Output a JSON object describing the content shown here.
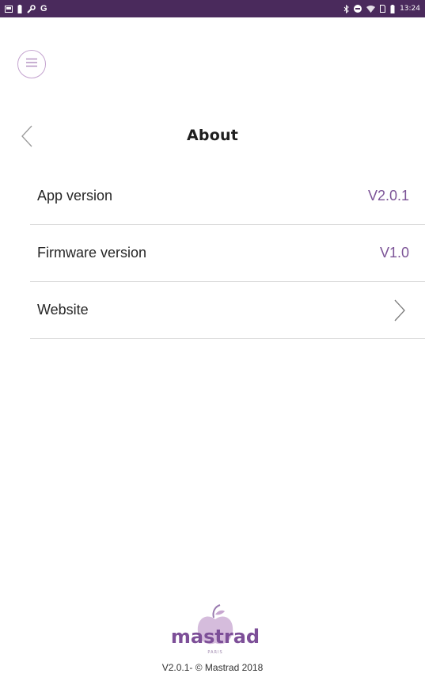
{
  "status_bar": {
    "time": "13:24",
    "left_icons": [
      "screenshot-icon",
      "battery-alert-icon",
      "wrench-icon",
      "google-icon"
    ],
    "right_icons": [
      "bluetooth-icon",
      "do-not-disturb-icon",
      "wifi-icon",
      "sim-icon",
      "battery-icon"
    ],
    "background": "#4a2a5c"
  },
  "header": {
    "menu_icon": "hamburger-menu-icon",
    "back_icon": "chevron-left-icon",
    "title": "About"
  },
  "rows": [
    {
      "label": "App version",
      "value": "V2.0.1"
    },
    {
      "label": "Firmware version",
      "value": "V1.0"
    },
    {
      "label": "Website",
      "icon": "chevron-right-icon"
    }
  ],
  "footer": {
    "logo_text": "mastrad",
    "logo_subtext": "PARIS",
    "version_text": "V2.0.1- © Mastrad 2018"
  },
  "colors": {
    "accent": "#7c5497",
    "menu_ring": "#c4a3cf",
    "divider": "#dddddd"
  }
}
